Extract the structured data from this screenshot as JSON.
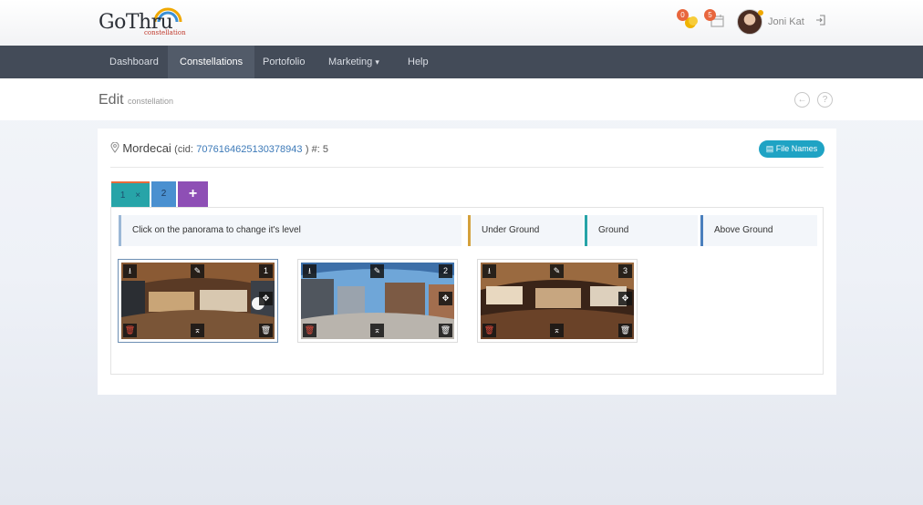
{
  "app": {
    "logo_text": "GoThru",
    "logo_sub": "constellation"
  },
  "header": {
    "notifications_count": "0",
    "calendar_count": "5",
    "user_name": "Joni Kat"
  },
  "nav": {
    "items": [
      {
        "label": "Dashboard"
      },
      {
        "label": "Constellations"
      },
      {
        "label": "Portofolio"
      },
      {
        "label": "Marketing"
      },
      {
        "label": "Help"
      }
    ],
    "marketing_caret": "▾"
  },
  "page": {
    "title": "Edit",
    "subtitle": "constellation",
    "back_icon": "←",
    "help_icon": "?"
  },
  "constellation": {
    "name": "Mordecai",
    "cid_prefix": "(cid:",
    "cid": "7076164625130378943",
    "cid_suffix": ") #: 5",
    "file_names_button": "File Names"
  },
  "tabs": [
    {
      "label": "1",
      "close": "×"
    },
    {
      "label": "2"
    },
    {
      "label": "+"
    }
  ],
  "levels": {
    "instruction": "Click on the panorama to change it's level",
    "under": "Under Ground",
    "ground": "Ground",
    "above": "Above Ground"
  },
  "panoramas": [
    {
      "number": "1"
    },
    {
      "number": "2"
    },
    {
      "number": "3"
    }
  ],
  "colors": {
    "nav_bg": "#434b58",
    "accent_teal": "#27a4a8",
    "accent_blue": "#4a90d0",
    "accent_purple": "#8e4fb5",
    "file_button": "#1fa3c4",
    "badge": "#e8663d"
  }
}
